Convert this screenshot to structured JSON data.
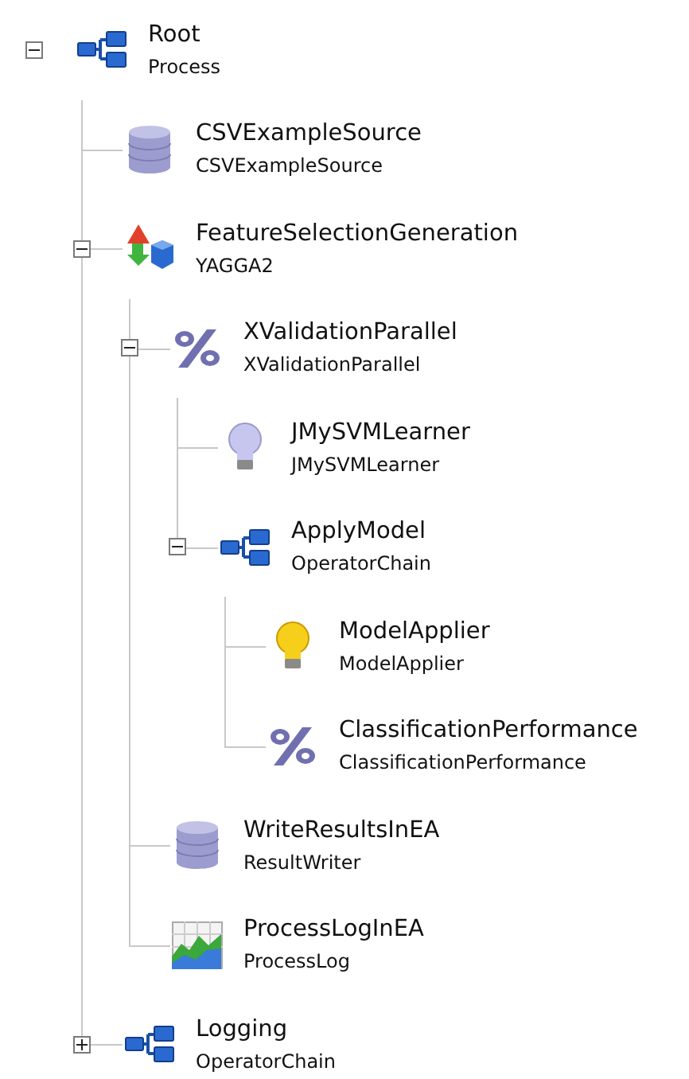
{
  "tree": {
    "name": "Root",
    "type": "Process",
    "kind": "chain",
    "expanded": true,
    "children": [
      {
        "name": "CSVExampleSource",
        "type": "CSVExampleSource",
        "kind": "database"
      },
      {
        "name": "FeatureSelectionGeneration",
        "type": "YAGGA2",
        "kind": "generator",
        "expanded": true,
        "children": [
          {
            "name": "XValidationParallel",
            "type": "XValidationParallel",
            "kind": "percent",
            "expanded": true,
            "children": [
              {
                "name": "JMySVMLearner",
                "type": "JMySVMLearner",
                "kind": "learner"
              },
              {
                "name": "ApplyModel",
                "type": "OperatorChain",
                "kind": "chain",
                "expanded": true,
                "children": [
                  {
                    "name": "ModelApplier",
                    "type": "ModelApplier",
                    "kind": "applier"
                  },
                  {
                    "name": "ClassificationPerformance",
                    "type": "ClassificationPerformance",
                    "kind": "percent"
                  }
                ]
              }
            ]
          },
          {
            "name": "WriteResultsInEA",
            "type": "ResultWriter",
            "kind": "database"
          },
          {
            "name": "ProcessLogInEA",
            "type": "ProcessLog",
            "kind": "chart"
          }
        ]
      },
      {
        "name": "Logging",
        "type": "OperatorChain",
        "kind": "chain",
        "expanded": false
      }
    ]
  }
}
